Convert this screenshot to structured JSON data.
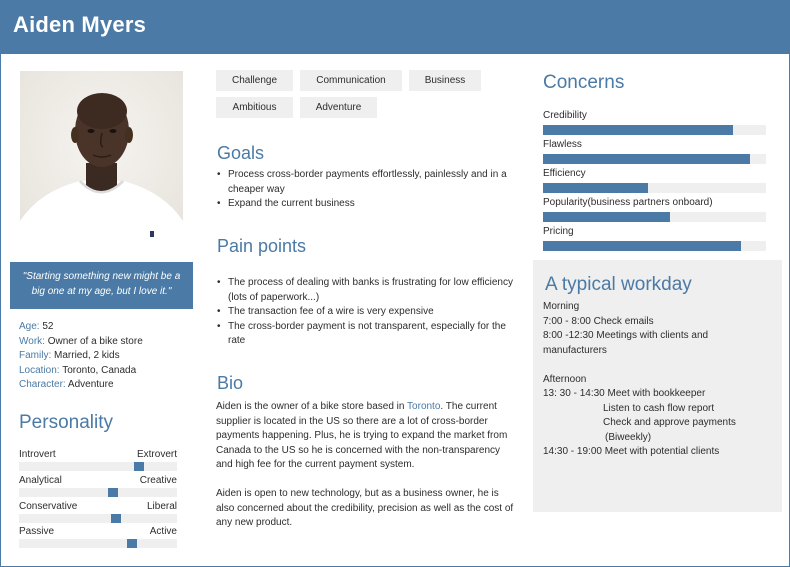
{
  "header": {
    "name": "Aiden Myers"
  },
  "quote": "\"Starting something new might be a big one at my age, but I love it.\"",
  "facts": [
    {
      "key": "Age:",
      "value": "52"
    },
    {
      "key": "Work:",
      "value": "Owner of a bike store"
    },
    {
      "key": "Family:",
      "value": "Married, 2 kids"
    },
    {
      "key": "Location:",
      "value": "Toronto, Canada"
    },
    {
      "key": "Character:",
      "value": "Adventure"
    }
  ],
  "personality": {
    "title": "Personality",
    "traits": [
      {
        "left": "Introvert",
        "right": "Extrovert",
        "level": 0.78
      },
      {
        "left": "Analytical",
        "right": "Creative",
        "level": 0.6
      },
      {
        "left": "Conservative",
        "right": "Liberal",
        "level": 0.62
      },
      {
        "left": "Passive",
        "right": "Active",
        "level": 0.73
      }
    ]
  },
  "tags": [
    "Challenge",
    "Communication",
    "Business",
    "Ambitious",
    "Adventure"
  ],
  "goals": {
    "title": "Goals",
    "items": [
      "Process cross-border payments effortlessly, painlessly and in a cheaper way",
      "Expand the current business"
    ]
  },
  "pain_points": {
    "title": "Pain points",
    "items": [
      "The process of dealing with banks is frustrating for low efficiency (lots of paperwork...)",
      "The transaction fee of a wire is very expensive",
      "The cross-border payment is not transparent, especially for the rate"
    ]
  },
  "bio": {
    "title": "Bio",
    "p1_before": "Aiden is the owner of a bike store based in ",
    "p1_link": "Toronto",
    "p1_after": ". The current supplier is located in the US so there are a lot of cross-border payments happening. Plus, he is trying to expand the market from Canada to the US so he is concerned with the non-transparency and high fee for the current payment system.",
    "p2": "Aiden is open to new technology, but as a business owner, he is also concerned about the credibility, precision as well as the cost of any new product."
  },
  "concerns": {
    "title": "Concerns",
    "items": [
      {
        "label": "Credibility",
        "level": 0.85
      },
      {
        "label": "Flawless",
        "level": 0.93
      },
      {
        "label": "Efficiency",
        "level": 0.47
      },
      {
        "label": "Popularity(business partners onboard)",
        "level": 0.57
      },
      {
        "label": "Pricing",
        "level": 0.89
      }
    ]
  },
  "workday": {
    "title": "A typical workday",
    "morning_label": "Morning",
    "morning": [
      "7:00 - 8:00 Check emails",
      "8:00 -12:30 Meetings with clients and",
      "manufacturers"
    ],
    "afternoon_label": "Afternoon",
    "afternoon_first": "13: 30 - 14:30 Meet with bookkeeper",
    "afternoon_sub": [
      "Listen to cash flow report",
      "Check and approve payments",
      "(Biweekly)"
    ],
    "afternoon_last": "14:30 - 19:00 Meet with potential clients"
  }
}
